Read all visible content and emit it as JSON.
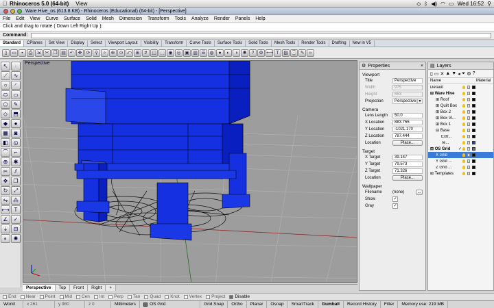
{
  "mac_menu": {
    "app_name": "Rhinoceros 5.0 (64-bit)",
    "view_label": "View",
    "clock": "Wed 16:52"
  },
  "window": {
    "title": "Ware Hive_os (613.8 KB) - Rhinoceros (Educational) (64-bit) - [Perspective]"
  },
  "menus": [
    "File",
    "Edit",
    "View",
    "Curve",
    "Surface",
    "Solid",
    "Mesh",
    "Dimension",
    "Transform",
    "Tools",
    "Analyze",
    "Render",
    "Panels",
    "Help"
  ],
  "command": {
    "prompt": "Click and drag to rotate ( Down  Left  Right  Up ):",
    "label": "Command:"
  },
  "toolbar_tabs": [
    "Standard",
    "CPlanes",
    "Set View",
    "Display",
    "Select",
    "Viewport Layout",
    "Visibility",
    "Transform",
    "Curve Tools",
    "Surface Tools",
    "Solid Tools",
    "Mesh Tools",
    "Render Tools",
    "Drafting",
    "New in V5"
  ],
  "viewport": {
    "label": "Perspective",
    "tabs": [
      "Perspective",
      "Top",
      "Front",
      "Right",
      "+"
    ]
  },
  "osnaps": [
    {
      "label": "End",
      "on": false
    },
    {
      "label": "Near",
      "on": false
    },
    {
      "label": "Point",
      "on": false
    },
    {
      "label": "Mid",
      "on": false
    },
    {
      "label": "Cen",
      "on": false
    },
    {
      "label": "Int",
      "on": false
    },
    {
      "label": "Perp",
      "on": false
    },
    {
      "label": "Tan",
      "on": false
    },
    {
      "label": "Quad",
      "on": false
    },
    {
      "label": "Knot",
      "on": false
    },
    {
      "label": "Vertex",
      "on": false
    },
    {
      "label": "Project",
      "on": false
    },
    {
      "label": "Disable",
      "on": true
    }
  ],
  "statusbar": {
    "cplane": "World",
    "x": "x 261",
    "y": "y 980",
    "z": "z 0",
    "units": "Millimeters",
    "layer": "OS Grid",
    "grid_snap": "Grid Snap",
    "ortho": "Ortho",
    "planar": "Planar",
    "osnap": "Osnap",
    "smarttrack": "SmartTrack",
    "gumball": "Gumball",
    "record_history": "Record History",
    "filter": "Filter",
    "memory": "Memory use: 219 MB"
  },
  "properties": {
    "header": "Properties",
    "viewport_section": "Viewport",
    "title_label": "Title",
    "title_value": "Perspective",
    "width_label": "Width",
    "width_value": "975",
    "height_label": "Height",
    "height_value": "653",
    "projection_label": "Projection",
    "projection_value": "Perspective",
    "camera_section": "Camera",
    "lens_label": "Lens Length",
    "lens_value": "50.0",
    "xloc_label": "X Location",
    "xloc_value": "883.755",
    "yloc_label": "Y Location",
    "yloc_value": "-1021.170",
    "zloc_label": "Z Location",
    "zloc_value": "787.444",
    "location_label": "Location",
    "place_button": "Place...",
    "target_section": "Target",
    "xt_label": "X Target",
    "xt_value": "39.147",
    "yt_label": "Y Target",
    "yt_value": "79.573",
    "zt_label": "Z Target",
    "zt_value": "71.326",
    "tloc_label": "Location",
    "tplace_button": "Place...",
    "wallpaper_section": "Wallpaper",
    "filename_label": "Filename",
    "filename_value": "(none)",
    "browse_button": "...",
    "show_label": "Show",
    "show_checked": "✓",
    "gray_label": "Gray",
    "gray_checked": "✓"
  },
  "layers": {
    "header": "Layers",
    "col_name": "Name",
    "col_material": "Material",
    "rows": [
      {
        "name": "Default",
        "indent": 0,
        "expander": "",
        "color": "#000000",
        "check": ""
      },
      {
        "name": "Ware Hive",
        "indent": 0,
        "expander": "⊟",
        "color": "#000000",
        "check": ""
      },
      {
        "name": "Roof",
        "indent": 1,
        "expander": "⊞",
        "color": "#000000",
        "check": ""
      },
      {
        "name": "Quilt Box",
        "indent": 1,
        "expander": "⊞",
        "color": "#000000",
        "check": ""
      },
      {
        "name": "Box 2",
        "indent": 1,
        "expander": "⊞",
        "color": "#000000",
        "check": ""
      },
      {
        "name": "Box Vi...",
        "indent": 1,
        "expander": "⊞",
        "color": "#000000",
        "check": ""
      },
      {
        "name": "Box 1",
        "indent": 1,
        "expander": "⊞",
        "color": "#000000",
        "check": ""
      },
      {
        "name": "Base",
        "indent": 1,
        "expander": "⊟",
        "color": "#000000",
        "check": ""
      },
      {
        "name": "Extr...",
        "indent": 2,
        "expander": "",
        "color": "#000000",
        "check": ""
      },
      {
        "name": "Te...",
        "indent": 2,
        "expander": "",
        "color": "#1a3cf0",
        "check": ""
      },
      {
        "name": "OS Grid",
        "indent": 0,
        "expander": "⊟",
        "color": "#6a6a6a",
        "check": "✓"
      },
      {
        "name": "X Grid",
        "indent": 1,
        "expander": "",
        "color": "#000000",
        "check": "",
        "selected": true
      },
      {
        "name": "Y Grid ...",
        "indent": 1,
        "expander": "",
        "color": "#000000",
        "check": ""
      },
      {
        "name": "Z Grid ...",
        "indent": 1,
        "expander": "",
        "color": "#000000",
        "check": ""
      },
      {
        "name": "Templates",
        "indent": 0,
        "expander": "⊞",
        "color": "#000000",
        "check": ""
      }
    ]
  }
}
